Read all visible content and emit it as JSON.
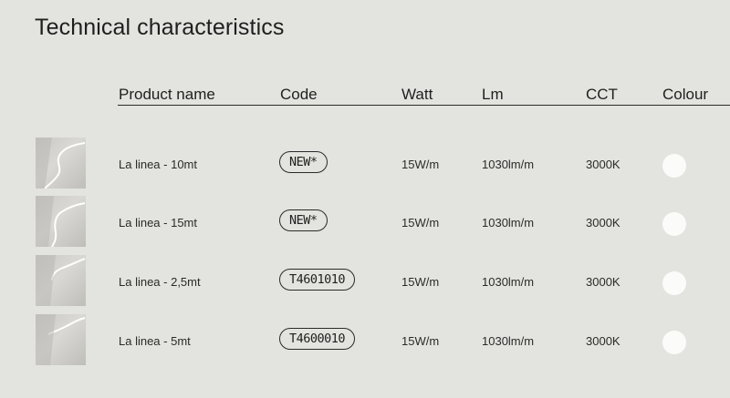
{
  "page": {
    "title": "Technical characteristics"
  },
  "table": {
    "headers": {
      "product": "Product name",
      "code": "Code",
      "watt": "Watt",
      "lm": "Lm",
      "cct": "CCT",
      "colour": "Colour"
    },
    "rows": [
      {
        "name": "La linea - 10mt",
        "code": "NEW*",
        "watt": "15W/m",
        "lm": "1030lm/m",
        "cct": "3000K",
        "colour": "#fbfbfa"
      },
      {
        "name": "La linea - 15mt",
        "code": "NEW*",
        "watt": "15W/m",
        "lm": "1030lm/m",
        "cct": "3000K",
        "colour": "#fbfbfa"
      },
      {
        "name": "La linea - 2,5mt",
        "code": "T4601010",
        "watt": "15W/m",
        "lm": "1030lm/m",
        "cct": "3000K",
        "colour": "#fbfbfa"
      },
      {
        "name": "La linea - 5mt",
        "code": "T4600010",
        "watt": "15W/m",
        "lm": "1030lm/m",
        "cct": "3000K",
        "colour": "#fbfbfa"
      }
    ]
  }
}
